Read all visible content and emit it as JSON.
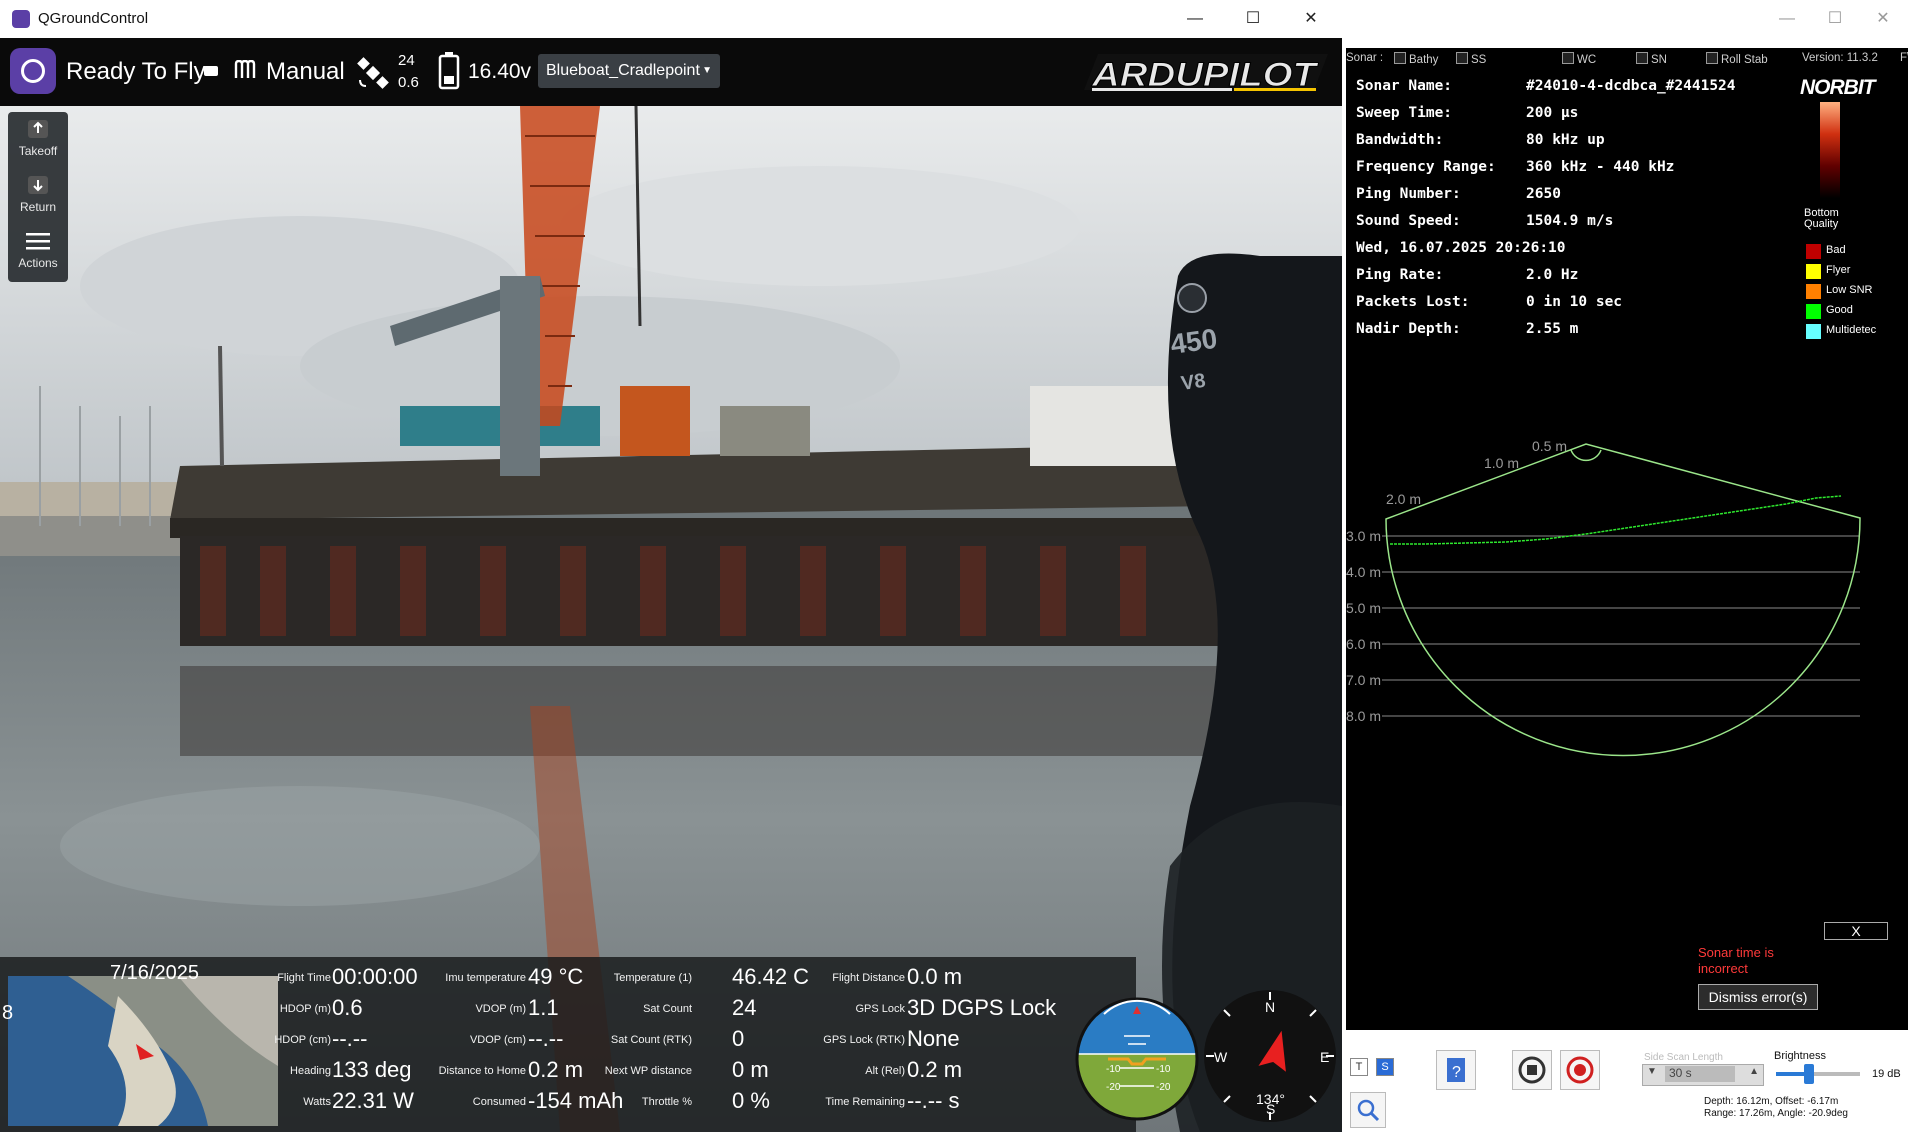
{
  "qgc": {
    "window_title": "QGroundControl",
    "toolbar": {
      "status": "Ready To Fly",
      "mode": "Manual",
      "sat_count": "24",
      "hdop": "0.6",
      "battery": "16.40v",
      "vehicle": "Blueboat_Cradlepoint",
      "brand": "ARDUPILOT"
    },
    "tools": [
      {
        "label": "Takeoff",
        "icon": "takeoff-icon"
      },
      {
        "label": "Return",
        "icon": "return-icon"
      },
      {
        "label": "Actions",
        "icon": "menu-icon"
      }
    ],
    "minimap_date": "7/16/2025",
    "telemetry": [
      {
        "label": "Flight Time",
        "value": "00:00:00"
      },
      {
        "label": "HDOP (m)",
        "value": "0.6"
      },
      {
        "label": "HDOP (cm)",
        "value": "--.--"
      },
      {
        "label": "Heading",
        "value": "133 deg"
      },
      {
        "label": "Watts",
        "value": "22.31 W"
      },
      {
        "label": "Imu temperature",
        "value": "49 °C"
      },
      {
        "label": "VDOP (m)",
        "value": "1.1"
      },
      {
        "label": "VDOP (cm)",
        "value": "--.--"
      },
      {
        "label": "Distance to Home",
        "value": "0.2 m"
      },
      {
        "label": "Consumed",
        "value": "-154 mAh"
      },
      {
        "label": "Temperature (1)",
        "value": "46.42 C"
      },
      {
        "label": "Sat Count",
        "value": "24"
      },
      {
        "label": "Sat Count (RTK)",
        "value": "0"
      },
      {
        "label": "Next WP distance",
        "value": "0 m"
      },
      {
        "label": "Throttle %",
        "value": "0 %"
      },
      {
        "label": "Flight Distance",
        "value": "0.0 m"
      },
      {
        "label": "GPS Lock",
        "value": "3D DGPS Lock"
      },
      {
        "label": "GPS Lock (RTK)",
        "value": "None"
      },
      {
        "label": "Alt (Rel)",
        "value": "0.2 m"
      },
      {
        "label": "Time Remaining",
        "value": "--.-- s"
      }
    ],
    "attitude": {
      "pitch_marks": [
        "-10",
        "-10",
        "-20",
        "-20"
      ]
    },
    "compass": {
      "n": "N",
      "e": "E",
      "s": "S",
      "w": "W",
      "heading": "134°"
    }
  },
  "norbit": {
    "checkbox_row": {
      "sonar_label": "Sonar :",
      "items": [
        "Bathy",
        "SS",
        "WC",
        "SN",
        "Roll Stab"
      ],
      "version": "Version: 11.3.2",
      "trail": "F\\"
    },
    "logo": "NORBIT",
    "info": [
      {
        "key": "Sonar Name:",
        "value": "#24010-4-dcdbca_#2441524"
      },
      {
        "key": "Sweep Time:",
        "value": "200 µs"
      },
      {
        "key": "Bandwidth:",
        "value": "80 kHz up"
      },
      {
        "key": "Frequency Range:",
        "value": "360 kHz - 440 kHz"
      },
      {
        "key": "Ping Number:",
        "value": "2650"
      },
      {
        "key": "Sound Speed:",
        "value": "1504.9 m/s"
      },
      {
        "key": "Wed, 16.07.2025 20:26:10",
        "value": ""
      },
      {
        "key": "Ping Rate:",
        "value": "2.0 Hz"
      },
      {
        "key": "Packets Lost:",
        "value": "0 in 10 sec"
      },
      {
        "key": "Nadir Depth:",
        "value": "2.55 m"
      }
    ],
    "quality_title": "Bottom Quality",
    "legend": [
      {
        "label": "Bad",
        "color": "#c00000"
      },
      {
        "label": "Flyer",
        "color": "#ffff00"
      },
      {
        "label": "Low SNR",
        "color": "#ff8000"
      },
      {
        "label": "Good",
        "color": "#00ff00"
      },
      {
        "label": "Multidetec",
        "color": "#66ffff"
      }
    ],
    "depth_rings": [
      "0.5 m",
      "1.0 m",
      "2.0 m"
    ],
    "depth_lines": [
      "3.0 m",
      "4.0 m",
      "5.0 m",
      "6.0 m",
      "7.0 m",
      "8.0 m"
    ],
    "error": {
      "close": "X",
      "message": "Sonar time is incorrect",
      "dismiss": "Dismiss error(s)"
    },
    "bottom": {
      "t_label": "T",
      "s_label": "S",
      "scan_label": "Side Scan Length",
      "scan_value": "30  s",
      "brightness_label": "Brightness",
      "brightness_value": "19  dB",
      "status_line1": "Depth: 16.12m,   Offset: -6.17m",
      "status_line2": "Range: 17.26m,   Angle: -20.9deg"
    }
  }
}
